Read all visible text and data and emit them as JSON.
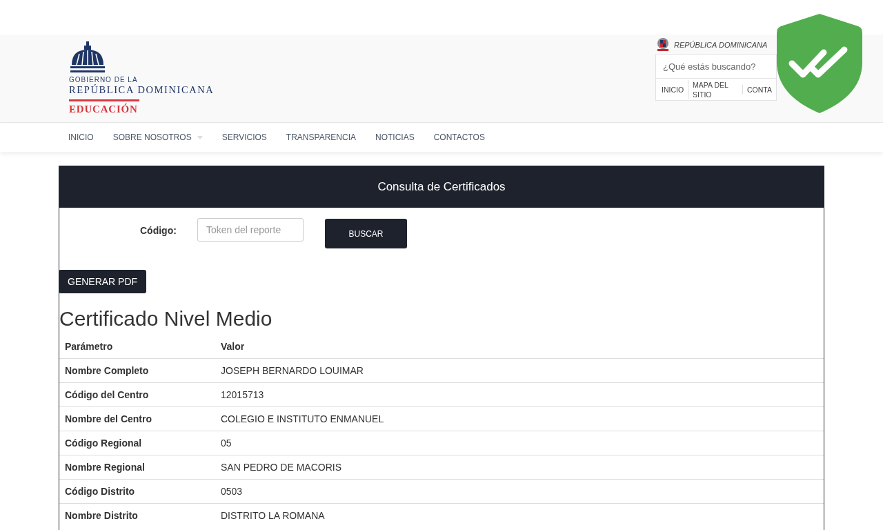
{
  "logo": {
    "line_1": "GOBIERNO DE LA",
    "line_2": "REPÚBLICA DOMINICANA",
    "line_3": "EDUCACIÓN"
  },
  "top_bar": {
    "country": "REPÚBLICA DOMINICANA",
    "search": {
      "placeholder": "¿Qué estás buscando?"
    },
    "links": [
      "INICIO",
      "MAPA DEL SITIO",
      "CONTA"
    ]
  },
  "nav": [
    {
      "label": "INICIO",
      "dropdown": false
    },
    {
      "label": "SOBRE NOSOTROS",
      "dropdown": true
    },
    {
      "label": "SERVICIOS",
      "dropdown": false
    },
    {
      "label": "TRANSPARENCIA",
      "dropdown": false
    },
    {
      "label": "NOTICIAS",
      "dropdown": false
    },
    {
      "label": "CONTACTOS",
      "dropdown": false
    }
  ],
  "panel": {
    "title": "Consulta de Certificados",
    "code_label": "Código:",
    "code_field": {
      "placeholder": "Token del reporte"
    },
    "search_button": "BUSCAR"
  },
  "pdf_button": "GENERAR PDF",
  "heading": "Certificado Nivel Medio",
  "table": {
    "columns": [
      "Parámetro",
      "Valor"
    ],
    "rows": [
      [
        "Nombre Completo",
        "JOSEPH BERNARDO LOUIMAR"
      ],
      [
        "Código del Centro",
        "12015713"
      ],
      [
        "Nombre del Centro",
        "COLEGIO E INSTITUTO ENMANUEL"
      ],
      [
        "Código Regional",
        "05"
      ],
      [
        "Nombre Regional",
        "SAN PEDRO DE MACORIS"
      ],
      [
        "Código Distrito",
        "0503"
      ],
      [
        "Nombre Distrito",
        "DISTRITO LA ROMANA"
      ]
    ]
  }
}
